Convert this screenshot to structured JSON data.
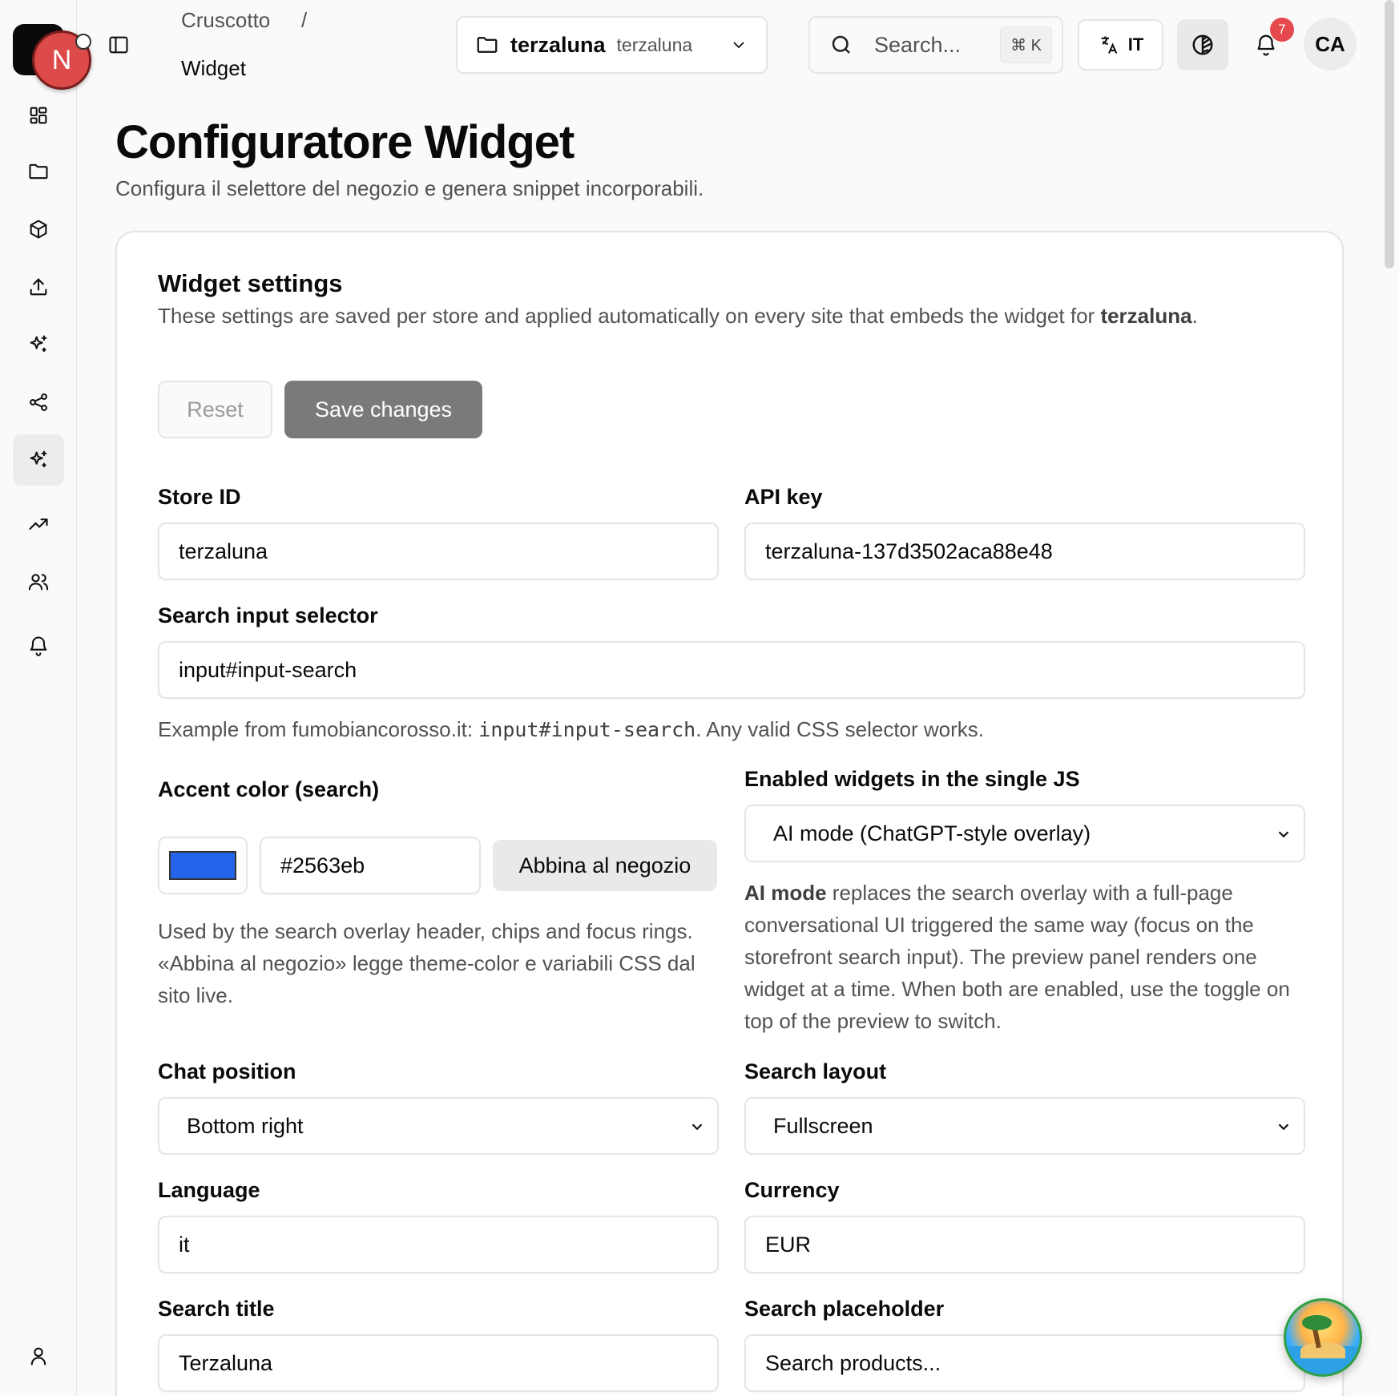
{
  "app": {
    "logo_letter": "N"
  },
  "sidebar": {
    "items": [
      {
        "icon": "dashboard-icon"
      },
      {
        "icon": "folder-icon"
      },
      {
        "icon": "package-icon"
      },
      {
        "icon": "upload-icon"
      },
      {
        "icon": "sparkles-icon"
      },
      {
        "icon": "share-icon"
      },
      {
        "icon": "sparkles-icon",
        "active": true
      },
      {
        "icon": "trending-up-icon"
      },
      {
        "icon": "users-icon"
      },
      {
        "icon": "bell-icon"
      }
    ],
    "footer_icon": "user-icon"
  },
  "breadcrumb": {
    "root": "Cruscotto",
    "separator": "/",
    "current": "Widget"
  },
  "topbar": {
    "store_name": "terzaluna",
    "store_sub": "terzaluna",
    "search_placeholder": "Search...",
    "search_shortcut": "⌘ K",
    "language": "IT",
    "notifications_count": "7",
    "avatar_initials": "CA"
  },
  "page": {
    "title": "Configuratore Widget",
    "subtitle": "Configura il selettore del negozio e genera snippet incorporabili."
  },
  "settings": {
    "title": "Widget settings",
    "desc_prefix": "These settings are saved per store and applied automatically on every site that embeds the widget for ",
    "desc_store": "terzaluna",
    "desc_suffix": ".",
    "reset_label": "Reset",
    "save_label": "Save changes",
    "store_id": {
      "label": "Store ID",
      "value": "terzaluna"
    },
    "api_key": {
      "label": "API key",
      "value": "terzaluna-137d3502aca88e48"
    },
    "search_selector": {
      "label": "Search input selector",
      "value": "input#input-search",
      "help_prefix": "Example from fumobiancorosso.it: ",
      "help_code": "input#input-search",
      "help_suffix": ". Any valid CSS selector works."
    },
    "accent": {
      "label": "Accent color (search)",
      "color": "#2563eb",
      "value": "#2563eb",
      "match_label": "Abbina al negozio",
      "help": "Used by the search overlay header, chips and focus rings. «Abbina al negozio» legge theme-color e variabili CSS dal sito live."
    },
    "enabled_widgets": {
      "label": "Enabled widgets in the single JS",
      "selected": "AI mode (ChatGPT-style overlay)",
      "help_bold": "AI mode",
      "help_rest": " replaces the search overlay with a full-page conversational UI triggered the same way (focus on the storefront search input). The preview panel renders one widget at a time. When both are enabled, use the toggle on top of the preview to switch."
    },
    "chat_position": {
      "label": "Chat position",
      "selected": "Bottom right"
    },
    "search_layout": {
      "label": "Search layout",
      "selected": "Fullscreen"
    },
    "language": {
      "label": "Language",
      "value": "it"
    },
    "currency": {
      "label": "Currency",
      "value": "EUR"
    },
    "search_title": {
      "label": "Search title",
      "value": "Terzaluna"
    },
    "search_placeholder": {
      "label": "Search placeholder",
      "value": "Search products..."
    }
  }
}
